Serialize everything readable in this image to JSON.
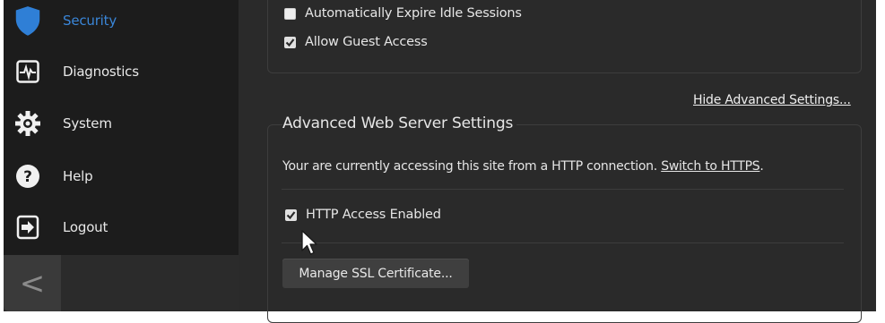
{
  "sidebar": {
    "items": [
      {
        "label": "Security",
        "icon": "shield-icon",
        "active": true
      },
      {
        "label": "Diagnostics",
        "icon": "pulse-icon"
      },
      {
        "label": "System",
        "icon": "gear-icon"
      },
      {
        "label": "Help",
        "icon": "help-icon"
      },
      {
        "label": "Logout",
        "icon": "logout-icon"
      }
    ],
    "collapse_glyph": "<",
    "active_color": "#3a86d8"
  },
  "session": {
    "auto_expire_label": "Automatically Expire Idle Sessions",
    "auto_expire_checked": false,
    "guest_access_label": "Allow Guest Access",
    "guest_access_checked": true
  },
  "advanced_toggle": "Hide Advanced Settings...",
  "web_server": {
    "legend": "Advanced Web Server Settings",
    "info_text": "Your are currently accessing this site from a HTTP connection.",
    "switch_link": "Switch to HTTPS",
    "info_suffix": ".",
    "http_access_label": "HTTP Access Enabled",
    "http_access_checked": true,
    "manage_ssl_button": "Manage SSL Certificate..."
  }
}
